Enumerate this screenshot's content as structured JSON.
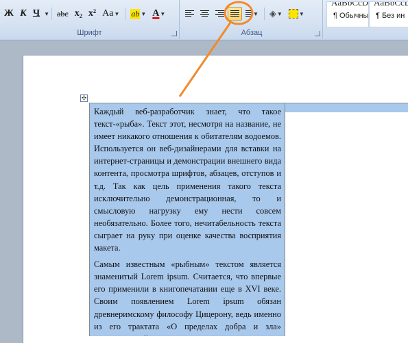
{
  "ribbon": {
    "font_group": {
      "label": "Шрифт",
      "bold": "Ж",
      "italic": "К",
      "underline": "Ч",
      "strike": "abc",
      "subscript": "x₂",
      "superscript": "x²",
      "change_case": "Aa",
      "highlight": "ab",
      "font_color": "A",
      "highlight_color": "#ffe400",
      "font_color_value": "#e02020"
    },
    "paragraph_group": {
      "label": "Абзац",
      "shading_color": "#ffe400"
    },
    "styles_group": {
      "styles": [
        {
          "sample": "AaBbCcD",
          "name": "¶ Обычный"
        },
        {
          "sample": "AaBbCcD",
          "name": "¶ Без ин"
        }
      ]
    }
  },
  "document": {
    "paragraphs": [
      "Каждый веб-разработчик знает, что такое текст-«рыба». Текст этот, несмотря на название, не имеет никакого отношения к обитателям водоемов. Используется он веб-дизайнерами для вставки на интернет-страницы и демонстрации внешнего вида контента, просмотра шрифтов, абзацев, отступов и т.д. Так как цель применения такого текста исключительно демонстрационная, то и смысловую нагрузку ему нести совсем необязательно. Более того, нечитабельность текста сыграет на руку при оценке качества восприятия макета.",
      "Самым известным «рыбным» текстом является знаменитый Lorem ipsum. Считается, что впервые его применили в книгопечатании еще в XVI веке. Своим появлением Lorem ipsum обязан древнеримскому философу Цицерону, ведь именно из его трактата «О пределах добра и зла» средневековый книгопечатник вырвал отдельные"
    ]
  },
  "annotation": {
    "color": "#f28a2c"
  }
}
